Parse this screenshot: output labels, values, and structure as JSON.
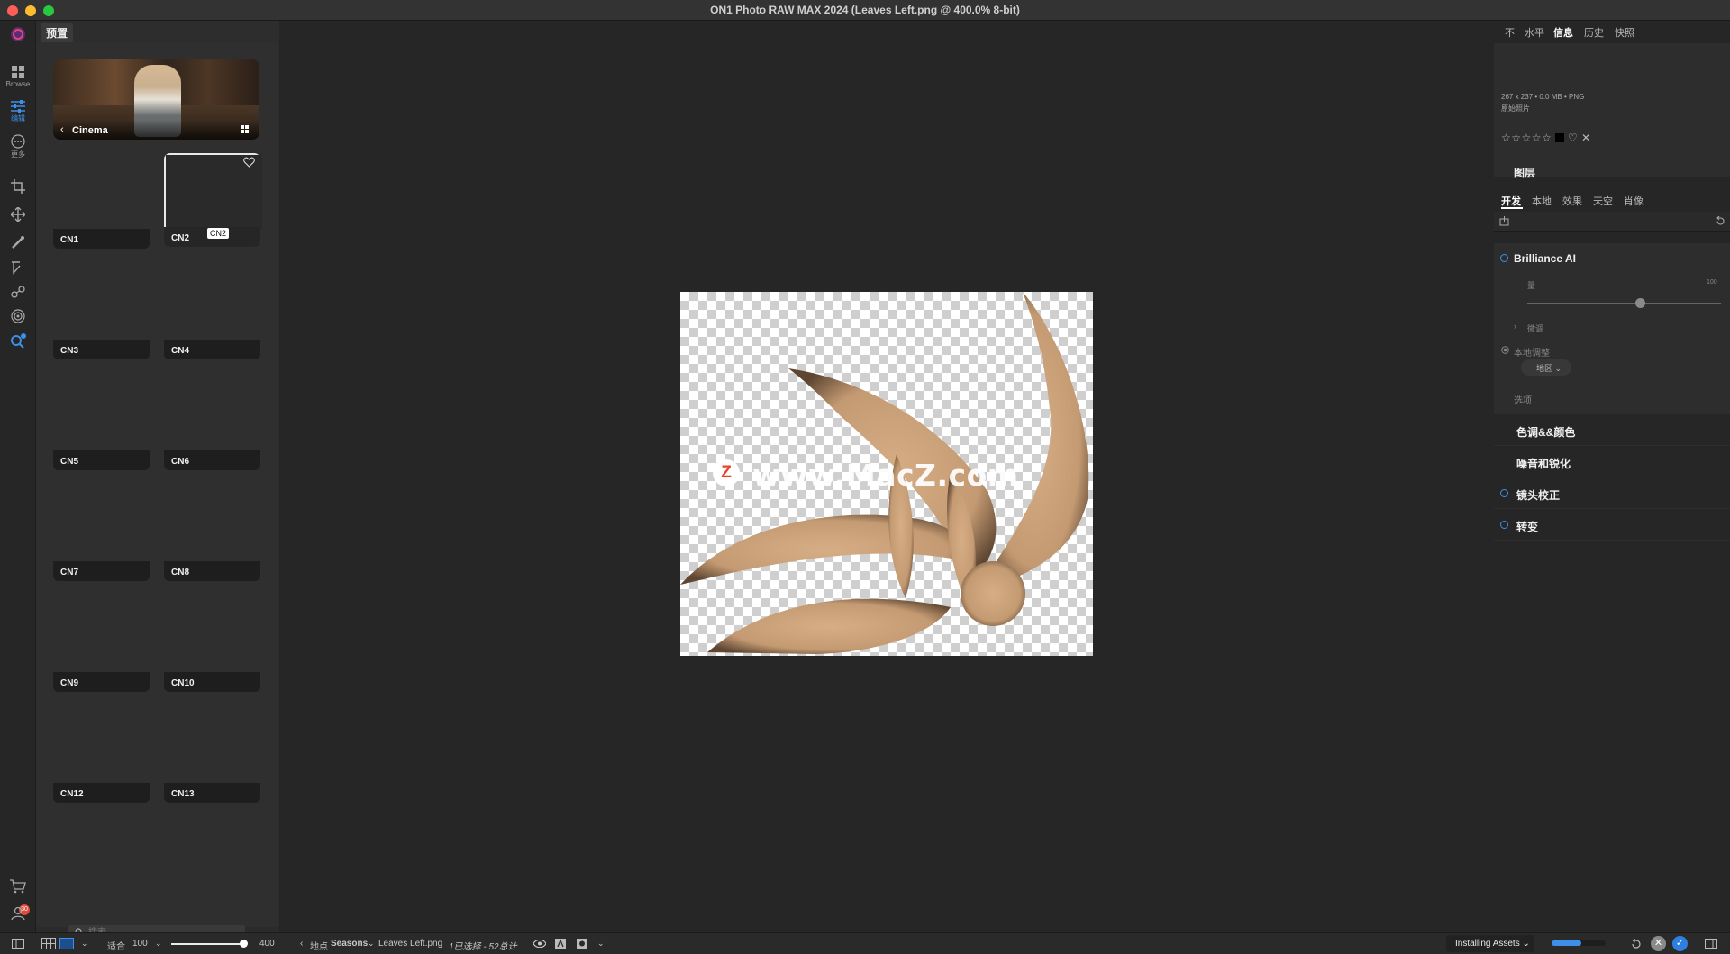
{
  "window": {
    "title": "ON1 Photo RAW MAX 2024 (Leaves Left.png @ 400.0% 8-bit)"
  },
  "rail": {
    "browse_label": "Browse",
    "edit_label": "编辑",
    "more_label": "更多",
    "cart_badge": "30",
    "accent": "#3d8fe8"
  },
  "presets": {
    "tab_label": "预置",
    "category": "Cinema",
    "items": [
      {
        "label": "CN1"
      },
      {
        "label": "CN2"
      },
      {
        "label": "CN3"
      },
      {
        "label": "CN4"
      },
      {
        "label": "CN5"
      },
      {
        "label": "CN6"
      },
      {
        "label": "CN7"
      },
      {
        "label": "CN8"
      },
      {
        "label": "CN9"
      },
      {
        "label": "CN10"
      },
      {
        "label": "CN12"
      },
      {
        "label": "CN13"
      }
    ],
    "selected_tooltip": "CN2",
    "search_placeholder": "搜索"
  },
  "canvas": {
    "watermark_letter": "Z",
    "watermark_text": "www.MacZ.com",
    "shape_color": "#c49a72"
  },
  "right": {
    "tabs": [
      "不",
      "水平",
      "信息",
      "历史",
      "快照"
    ],
    "active_tab": "信息",
    "info": {
      "dimensions": "267 x 237 • 0.0 MB • PNG",
      "status": "原始照片",
      "rating": "☆☆☆☆☆"
    },
    "layers_title": "图层",
    "develop_tabs": [
      "开发",
      "本地",
      "效果",
      "天空",
      "肖像"
    ],
    "brilliance": {
      "title": "Brilliance AI",
      "amount_label": "量",
      "amount_max": "100",
      "amount_fraction": 0.58,
      "finetune_label": "微调",
      "local_adjust_label": "本地调整",
      "region_label": "地区",
      "options_label": "选项"
    },
    "sections": [
      "色调&&颜色",
      "噪音和锐化",
      "镜头校正",
      "转变"
    ]
  },
  "bottom": {
    "fit_label": "适合",
    "zoom_value": "100",
    "zoom_max": "400",
    "zoom_fraction": 0.97,
    "location_label": "地点",
    "folder": "Seasons",
    "filename": "Leaves Left.png",
    "selection": "1已选择 - 52总计",
    "status": "Installing Assets",
    "progress_fraction": 0.55
  }
}
